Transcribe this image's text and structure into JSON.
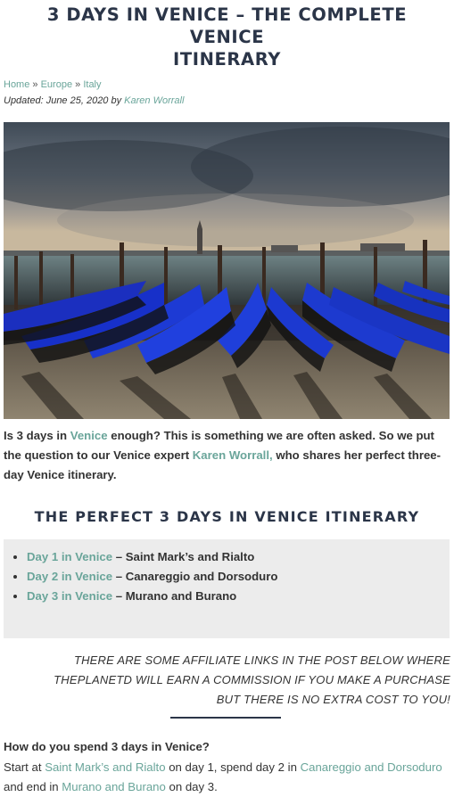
{
  "article": {
    "title_line1": "3 DAYS IN VENICE – THE COMPLETE VENICE",
    "title_line2": "ITINERARY"
  },
  "breadcrumb": {
    "items": [
      "Home",
      "Europe",
      "Italy"
    ],
    "separator": "»"
  },
  "meta": {
    "updated_prefix": "Updated: June 25, 2020 by",
    "author": "Karen Worrall"
  },
  "hero": {
    "subject": "gondolas-moored-venice-lagoon"
  },
  "intro": {
    "part1": "Is 3 days in ",
    "link1": "Venice",
    "part2": " enough? This is something we are often asked. So we put the question to our Venice expert ",
    "link2": "Karen Worrall,",
    "part3": " who shares her perfect three-day Venice itinerary."
  },
  "itinerary": {
    "heading": "THE PERFECT 3 DAYS IN VENICE ITINERARY",
    "days": [
      {
        "link": "Day 1 in Venice",
        "desc": " – Saint Mark’s and Rialto"
      },
      {
        "link": "Day 2 in Venice",
        "desc": " – Canareggio and Dorsoduro"
      },
      {
        "link": "Day 3 in Venice",
        "desc": " – Murano and Burano"
      }
    ]
  },
  "disclaimer": {
    "line1": "THERE ARE SOME AFFILIATE LINKS IN THE POST BELOW WHERE",
    "line2": "THEPLANETD WILL EARN A COMMISSION IF YOU MAKE A PURCHASE",
    "line3": "BUT THERE IS NO EXTRA COST TO YOU!"
  },
  "faq": {
    "question": "How do you spend 3 days in Venice?",
    "a1": "Start at ",
    "a_link1": "Saint Mark’s and Rialto",
    "a2": " on day 1, spend day 2 in ",
    "a_link2": "Canareggio and Dorsoduro",
    "a3": " and end in ",
    "a_link3": "Murano and Burano",
    "a4": " on day 3."
  },
  "colors": {
    "link": "#6aa59a",
    "heading": "#2b3548",
    "box_bg": "#ececec"
  }
}
